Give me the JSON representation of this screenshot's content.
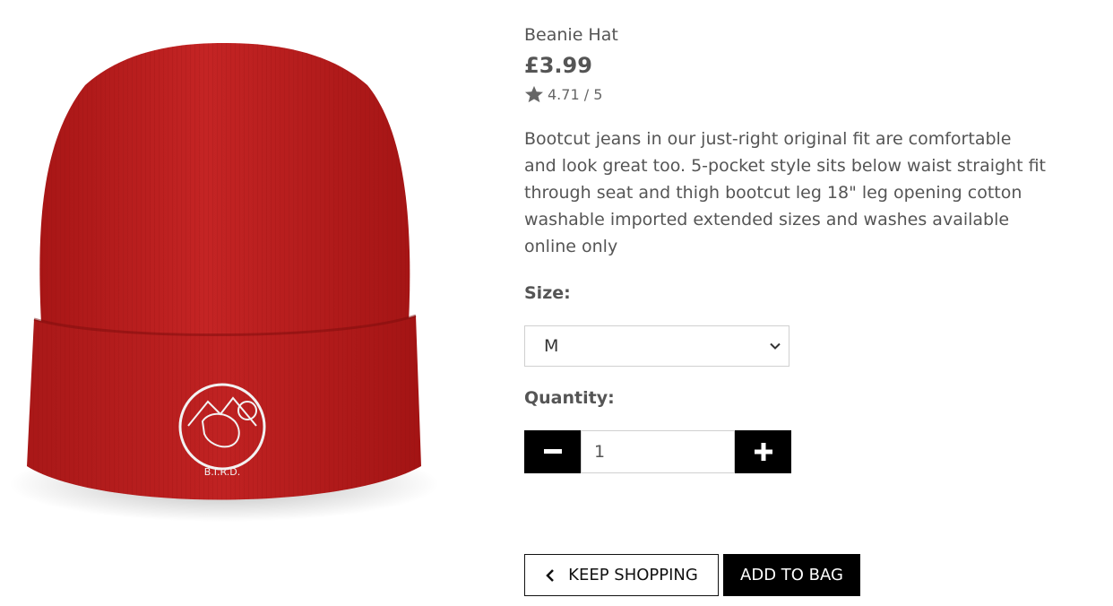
{
  "product": {
    "name": "Beanie Hat",
    "price": "£3.99",
    "rating": "4.71 / 5",
    "description": "Bootcut jeans in our just-right original fit are comfortable and look great too. 5-pocket style sits below waist straight fit through seat and thigh bootcut leg 18\" leg opening cotton washable imported extended sizes and washes available online only",
    "image_logo_text": "B.I.R.D."
  },
  "size": {
    "label": "Size:",
    "selected": "M"
  },
  "quantity": {
    "label": "Quantity:",
    "value": "1"
  },
  "actions": {
    "keep_shopping": "KEEP SHOPPING",
    "add_to_bag": "ADD TO BAG"
  },
  "colors": {
    "hat": "#b81f1f",
    "button": "#000000"
  }
}
